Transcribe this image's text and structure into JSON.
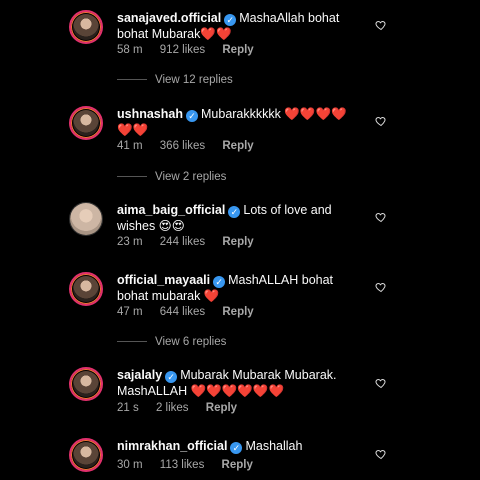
{
  "comments": [
    {
      "username": "sanajaved.official",
      "verified": true,
      "text": "MashaAllah bohat bohat Mubarak❤️❤️",
      "time": "58 m",
      "likes": "912 likes",
      "reply": "Reply",
      "view_replies": "View 12 replies"
    },
    {
      "username": "ushnashah",
      "verified": true,
      "text": "Mubarakkkkkk ❤️❤️❤️❤️❤️❤️",
      "time": "41 m",
      "likes": "366 likes",
      "reply": "Reply",
      "view_replies": "View 2 replies"
    },
    {
      "username": "aima_baig_official",
      "verified": true,
      "text": "Lots of love and wishes 😍😍",
      "time": "23 m",
      "likes": "244 likes",
      "reply": "Reply"
    },
    {
      "username": "official_mayaali",
      "verified": true,
      "text": "MashALLAH bohat bohat mubarak ❤️",
      "time": "47 m",
      "likes": "644 likes",
      "reply": "Reply",
      "view_replies": "View 6 replies"
    },
    {
      "username": "sajalaly",
      "verified": true,
      "text": "Mubarak Mubarak Mubarak. MashALLAH ❤️❤️❤️❤️❤️❤️",
      "time": "21 s",
      "likes": "2 likes",
      "reply": "Reply"
    },
    {
      "username": "nimrakhan_official",
      "verified": true,
      "text": "Mashallah",
      "time": "30 m",
      "likes": "113 likes",
      "reply": "Reply"
    }
  ],
  "icons": {
    "verified": "verified-badge-icon",
    "like": "heart-outline-icon"
  },
  "colors": {
    "background": "#000000",
    "verified": "#3897f0",
    "story_ring": "#e1306c",
    "meta": "#a8a8a8"
  }
}
